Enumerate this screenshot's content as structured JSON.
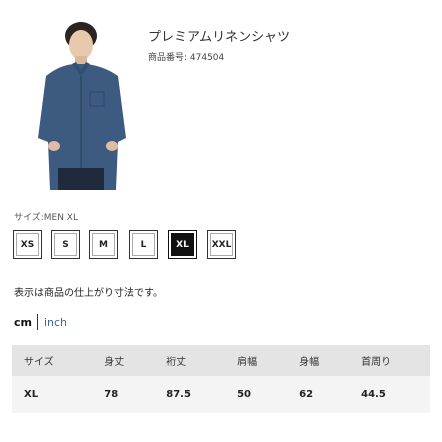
{
  "product": {
    "name": "プレミアムリネンシャツ",
    "id_text": "商品番号: 474504"
  },
  "size_selector": {
    "label": "サイズ:MEN XL",
    "options": [
      "XS",
      "S",
      "M",
      "L",
      "XL",
      "XXL"
    ],
    "selected": "XL"
  },
  "note": "表示は商品の仕上がり寸法です。",
  "unit_toggle": {
    "cm": "cm",
    "inch": "inch",
    "active": "cm"
  },
  "size_table": {
    "headers": [
      "サイズ",
      "身丈",
      "裄丈",
      "肩幅",
      "身幅",
      "首周り"
    ],
    "rows": [
      [
        "XL",
        "78",
        "87.5",
        "50",
        "62",
        "44.5"
      ]
    ]
  },
  "colors": {
    "shirt": "#3d5a80",
    "selected_bg": "#111111",
    "link": "#3a6aa0"
  }
}
